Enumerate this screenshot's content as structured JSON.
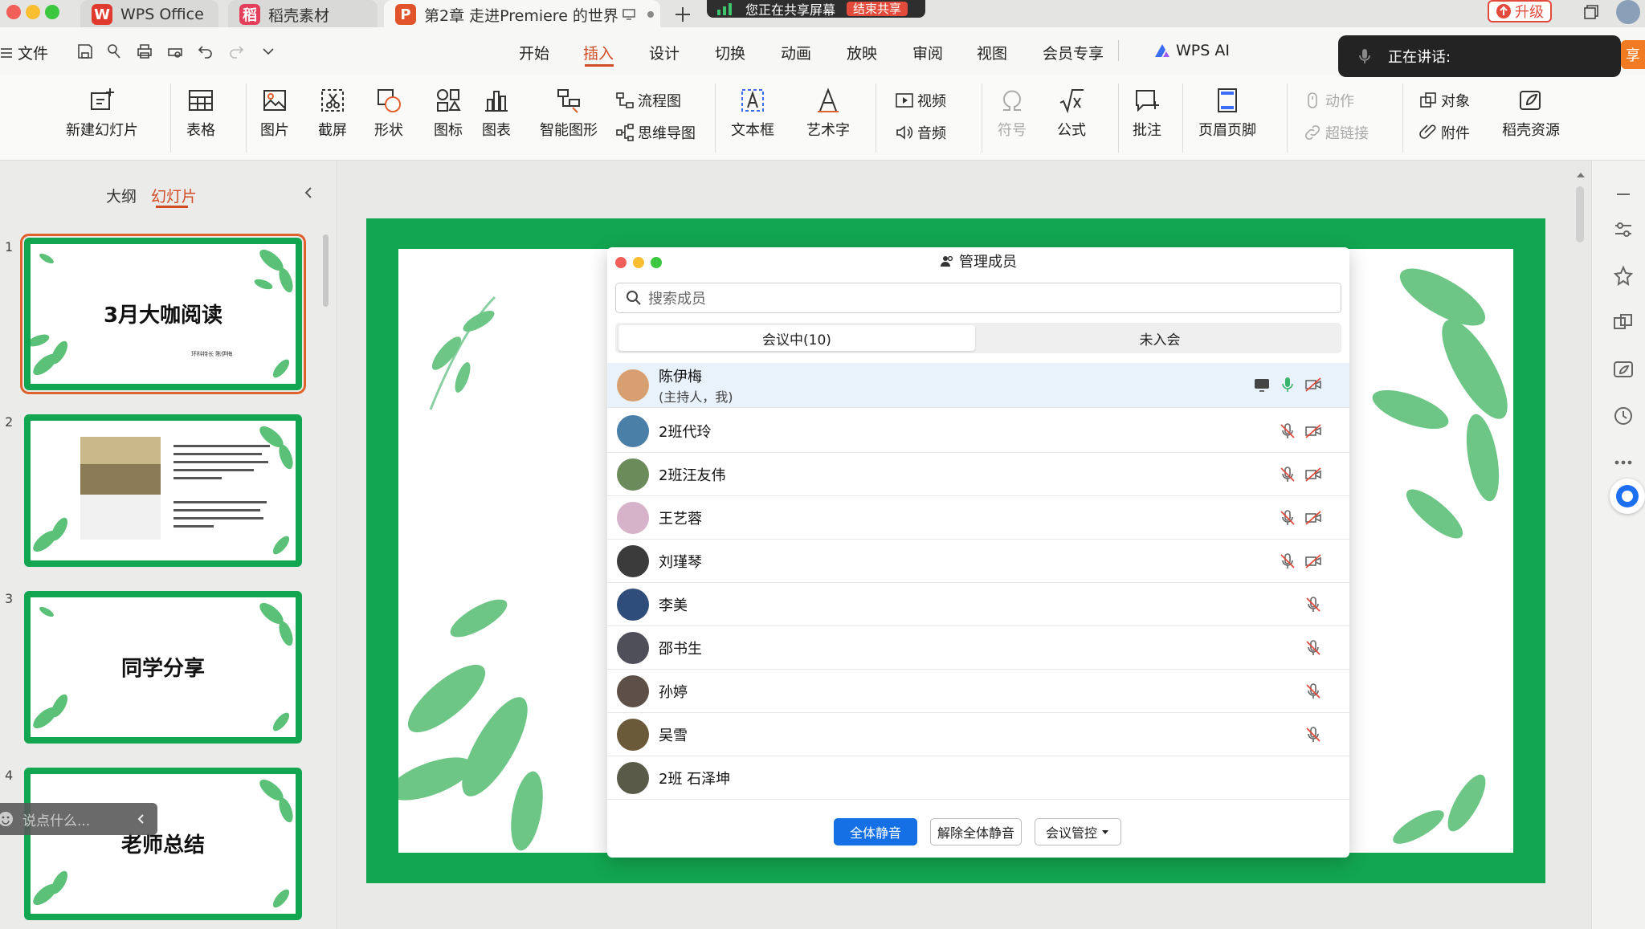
{
  "titlebar": {
    "tabs": [
      {
        "label": "WPS Office",
        "icon": "W"
      },
      {
        "label": "稻壳素材",
        "icon": "稻"
      },
      {
        "label": "第2章  走进Premiere 的世界",
        "icon": "P"
      }
    ],
    "share_status": "您正在共享屏幕",
    "end_share": "结束共享",
    "upgrade": "升级"
  },
  "menubar": {
    "file": "文件",
    "items": [
      "开始",
      "插入",
      "设计",
      "切换",
      "动画",
      "放映",
      "审阅",
      "视图",
      "会员专享"
    ],
    "active": "插入",
    "wps_ai": "WPS AI"
  },
  "ribbon": {
    "new_slide": "新建幻灯片",
    "table": "表格",
    "picture": "图片",
    "screenshot": "截屏",
    "shape": "形状",
    "icon": "图标",
    "chart": "图表",
    "smart_shape": "智能图形",
    "flowchart": "流程图",
    "mindmap": "思维导图",
    "textbox": "文本框",
    "wordart": "艺术字",
    "video": "视频",
    "audio": "音频",
    "symbol": "符号",
    "formula": "公式",
    "comment": "批注",
    "header_footer": "页眉页脚",
    "action": "动作",
    "hyperlink": "超链接",
    "object": "对象",
    "attachment": "附件",
    "daoke": "稻壳资源"
  },
  "leftpanel": {
    "tab_outline": "大纲",
    "tab_slides": "幻灯片",
    "slides": [
      {
        "num": "1",
        "title": "3月大咖阅读",
        "subtitle": "环科特长  陈伊梅"
      },
      {
        "num": "2",
        "title": ""
      },
      {
        "num": "3",
        "title": "同学分享"
      },
      {
        "num": "4",
        "title": "老师总结"
      }
    ]
  },
  "meeting": {
    "title": "管理成员",
    "search_placeholder": "搜索成员",
    "tab_in": "会议中(10)",
    "tab_out": "未入会",
    "members": [
      {
        "name": "陈伊梅",
        "sub": "(主持人，我)",
        "color": "#d8a070",
        "host": true
      },
      {
        "name": "2班代玲",
        "color": "#4a7fa8"
      },
      {
        "name": "2班汪友伟",
        "color": "#6b8b5a"
      },
      {
        "name": "王艺蓉",
        "color": "#d6b3c8"
      },
      {
        "name": "刘瑾琴",
        "color": "#3b3b3b"
      },
      {
        "name": "李美",
        "color": "#2e4d7a"
      },
      {
        "name": "邵书生",
        "color": "#4f4f5a"
      },
      {
        "name": "孙婷",
        "color": "#5d5048"
      },
      {
        "name": "吴雪",
        "color": "#6b5a3a"
      },
      {
        "name": "2班 石泽坤",
        "color": "#5a5a48"
      }
    ],
    "btn_mute_all": "全体静音",
    "btn_unmute_all": "解除全体静音",
    "btn_control": "会议管控"
  },
  "overlay": {
    "speaking": "正在讲话:",
    "chat_placeholder": "说点什么...",
    "share_right": "享"
  },
  "colors": {
    "accent": "#d14b25",
    "slide_green": "#12a650",
    "primary_blue": "#1570e5"
  }
}
